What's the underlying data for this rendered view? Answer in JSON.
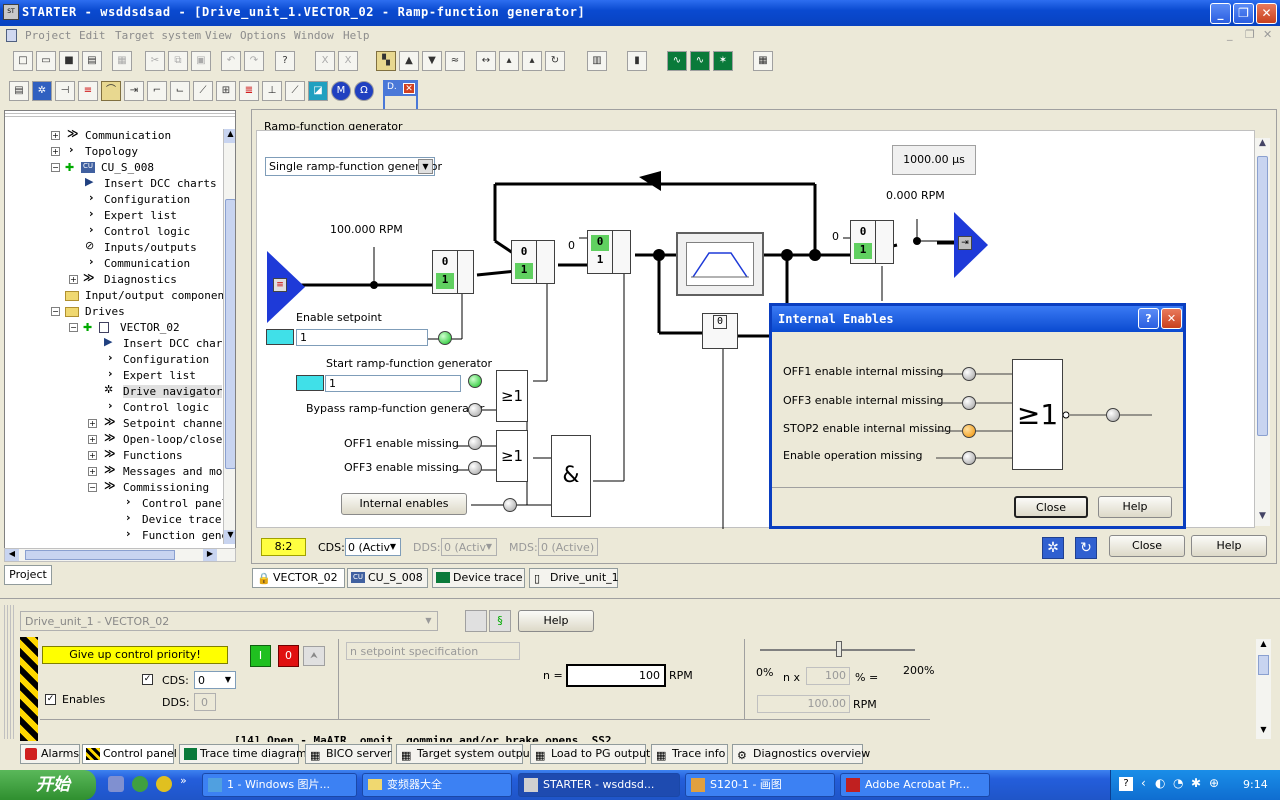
{
  "window": {
    "title": "STARTER - wsddsdsad - [Drive_unit_1.VECTOR_02 - Ramp-function generator]"
  },
  "menu": [
    "Project",
    "Edit",
    "Target system",
    "View",
    "Options",
    "Window",
    "Help"
  ],
  "floating_toolbar": {
    "title": "D."
  },
  "tree": {
    "items": [
      {
        "label": "Communication"
      },
      {
        "label": "Topology"
      },
      {
        "label": "CU_S_008"
      },
      {
        "label": "Insert DCC charts"
      },
      {
        "label": "Configuration"
      },
      {
        "label": "Expert list"
      },
      {
        "label": "Control logic"
      },
      {
        "label": "Inputs/outputs"
      },
      {
        "label": "Communication"
      },
      {
        "label": "Diagnostics"
      },
      {
        "label": "Input/output component"
      },
      {
        "label": "Drives"
      },
      {
        "label": "VECTOR_02"
      },
      {
        "label": "Insert DCC chart"
      },
      {
        "label": "Configuration"
      },
      {
        "label": "Expert list"
      },
      {
        "label": "Drive navigator"
      },
      {
        "label": "Control logic"
      },
      {
        "label": "Setpoint channel"
      },
      {
        "label": "Open-loop/closed"
      },
      {
        "label": "Functions"
      },
      {
        "label": "Messages and mon"
      },
      {
        "label": "Commissioning"
      },
      {
        "label": "Control panel"
      },
      {
        "label": "Device trace"
      },
      {
        "label": "Function gene"
      }
    ],
    "tab": "Project"
  },
  "rfg": {
    "title": "Ramp-function generator",
    "mode": "Single ramp-function generator",
    "cycle": "1000.00 µs",
    "speed_in": "100.000 RPM",
    "speed_out": "0.000 RPM",
    "enable_setpoint": "Enable setpoint",
    "enable_setpoint_val": "1",
    "start_rfg": "Start ramp-function generator",
    "start_rfg_val": "1",
    "bypass": "Bypass ramp-function generator",
    "off1": "OFF1 enable missing",
    "off3": "OFF3 enable missing",
    "internal_enables": "Internal enables",
    "ge1": "≥1",
    "and": "&",
    "zero": "0",
    "one": "1",
    "status": "8:2",
    "cds_label": "CDS:",
    "cds_val": "0 (Activ",
    "dds_label": "DDS:",
    "dds_val": "0 (Activ",
    "mds_label": "MDS:",
    "mds_val": "0 (Active)",
    "close": "Close",
    "help": "Help"
  },
  "dialog": {
    "title": "Internal Enables",
    "rows": [
      "OFF1 enable internal missing",
      "OFF3 enable internal missing",
      "STOP2 enable internal missing",
      "Enable operation missing"
    ],
    "ge1": "≥1",
    "close": "Close",
    "help": "Help"
  },
  "doc_tabs": [
    "VECTOR_02",
    "CU_S_008",
    "Device trace",
    "Drive_unit_1"
  ],
  "control_panel": {
    "drive": "Drive_unit_1 - VECTOR_02",
    "help": "Help",
    "give_up": "Give up control priority!",
    "btn_on": "I",
    "btn_off": "0",
    "enables": "Enables",
    "cds": "CDS:",
    "cds_val": "0",
    "dds": "DDS:",
    "dds_val": "0",
    "setpoint_spec": "n setpoint specification",
    "n_label": "n =",
    "n_val": "100",
    "rpm": "RPM",
    "pct0": "0%",
    "pct200": "200%",
    "nx": "n x",
    "nx_val": "100",
    "pct_eq": "% =",
    "rpm_val": "100.00",
    "rpm2": "RPM",
    "marquee": "[14] Open - MaAIR. omoit, gomming and/or brake opens. SS2"
  },
  "bottom_tabs": [
    "Alarms",
    "Control panel",
    "Trace time diagram",
    "BICO server",
    "Target system output",
    "Load to PG output",
    "Trace info",
    "Diagnostics overview"
  ],
  "taskbar": {
    "start": "开始",
    "tasks": [
      "1 - Windows 图片...",
      "变频器大全",
      "STARTER - wsddsd...",
      "S120-1 - 画图",
      "Adobe Acrobat Pr..."
    ],
    "time": "9:14"
  }
}
